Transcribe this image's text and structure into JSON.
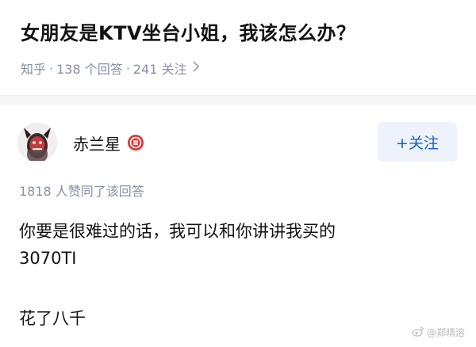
{
  "question": {
    "title": "女朋友是KTV坐台小姐，我该怎么办？",
    "source": "知乎",
    "answers": "138 个回答",
    "followers": "241 关注"
  },
  "answer": {
    "author_name": "赤兰星",
    "follow_label": "+关注",
    "upvote_text": "1818 人赞同了该回答",
    "content_lines": [
      "你要是很难过的话，我可以和你讲讲我买的",
      "3070TI",
      "花了八千"
    ]
  },
  "watermark": {
    "text": "@郑晴溶"
  },
  "icons": {
    "avatar": "masked-figure-avatar",
    "badge": "red-round-badge-icon",
    "chevron": "chevron-right-icon",
    "weibo": "weibo-logo-icon"
  },
  "colors": {
    "title": "#121212",
    "meta": "#8590a6",
    "follow_text": "#1a5fd0",
    "follow_bg": "#eef3fb",
    "badge": "#d93a3a"
  }
}
